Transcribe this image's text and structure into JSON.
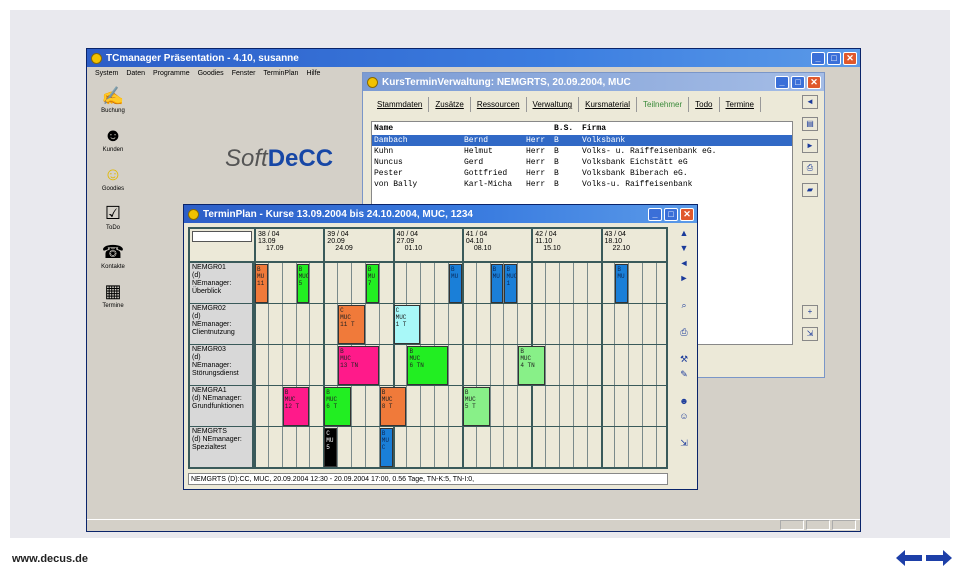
{
  "footer": {
    "url": "www.decus.de"
  },
  "app": {
    "title": "TCmanager Präsentation - 4.10, susanne",
    "menu": [
      "System",
      "Daten",
      "Programme",
      "Goodies",
      "Fenster",
      "TerminPlan",
      "Hilfe"
    ],
    "sidebar": [
      {
        "icon": "booking-icon",
        "label": "Buchung"
      },
      {
        "icon": "customers-icon",
        "label": "Kunden"
      },
      {
        "icon": "smiley-icon",
        "label": "Goodies"
      },
      {
        "icon": "todo-icon",
        "label": "ToDo"
      },
      {
        "icon": "phone-icon",
        "label": "Kontakte"
      },
      {
        "icon": "calendar-icon",
        "label": "Termine"
      }
    ],
    "logo_a": "Soft",
    "logo_b": "DeCC"
  },
  "kurs": {
    "title": "KursTerminVerwaltung: NEMGRTS, 20.09.2004, MUC",
    "tabs": [
      "Stammdaten",
      "Zusätze",
      "Ressourcen",
      "Verwaltung",
      "Kursmaterial",
      "Teilnehmer",
      "Todo",
      "Termine"
    ],
    "active_tab": "Teilnehmer",
    "headers": {
      "name": "Name",
      "vorname": "",
      "anrede": "",
      "bs": "B.S.",
      "firma": "Firma"
    },
    "rows": [
      {
        "name": "Dambach",
        "vorname": "Bernd",
        "anrede": "Herr",
        "bs": "B",
        "firma": "Volksbank"
      },
      {
        "name": "Kuhn",
        "vorname": "Helmut",
        "anrede": "Herr",
        "bs": "B",
        "firma": "Volks- u. Raiffeisenbank eG."
      },
      {
        "name": "Nuncus",
        "vorname": "Gerd",
        "anrede": "Herr",
        "bs": "B",
        "firma": "Volksbank Eichstätt eG"
      },
      {
        "name": "Pester",
        "vorname": "Gottfried",
        "anrede": "Herr",
        "bs": "B",
        "firma": "Volksbank Biberach eG."
      },
      {
        "name": "von Bally",
        "vorname": "Karl-Micha",
        "anrede": "Herr",
        "bs": "B",
        "firma": "Volks-u. Raiffeisenbank"
      }
    ]
  },
  "tp": {
    "title": "TerminPlan - Kurse 13.09.2004 bis 24.10.2004, MUC, 1234",
    "weeks": [
      {
        "w": "38 / 04",
        "d1": "13.09",
        "d2": "17.09"
      },
      {
        "w": "39 / 04",
        "d1": "20.09",
        "d2": "24.09"
      },
      {
        "w": "40 / 04",
        "d1": "27.09",
        "d2": "01.10"
      },
      {
        "w": "41 / 04",
        "d1": "04.10",
        "d2": "08.10"
      },
      {
        "w": "42 / 04",
        "d1": "11.10",
        "d2": "15.10"
      },
      {
        "w": "43 / 04",
        "d1": "18.10",
        "d2": "22.10"
      }
    ],
    "rows": [
      {
        "code": "NEMGR01",
        "l2": "(d)",
        "l3": "NEmanager:",
        "l4": "Überblick"
      },
      {
        "code": "NEMGR02",
        "l2": "(d)",
        "l3": "NEmanager:",
        "l4": "Clientnutzung"
      },
      {
        "code": "NEMGR03",
        "l2": "(d)",
        "l3": "NEmanager:",
        "l4": "Störungsdienst"
      },
      {
        "code": "NEMGRA1",
        "l2": "(d)  NEmanager:",
        "l3": "Grundfunktionen",
        "l4": ""
      },
      {
        "code": "NEMGRTS",
        "l2": "(d)  NEmanager:",
        "l3": "Spezialtest",
        "l4": ""
      }
    ],
    "status": "NEMGRTS   (D):CC, MUC, 20.09.2004 12:30 - 20.09.2004 17:00,   0.56 Tage, TN-K:5, TN-I:0,",
    "colors": {
      "orange": "#f07a3a",
      "green": "#22ee22",
      "blue": "#1a7fd8",
      "pink": "#ff1a8a",
      "cyan": "#a8f8f8",
      "lgreen": "#88f088",
      "black": "#000000"
    },
    "blocks": [
      {
        "row": 0,
        "col": 0,
        "text": "B\nMU\n11",
        "color": "orange"
      },
      {
        "row": 0,
        "col": 3,
        "text": "B\nMUC\n5",
        "color": "green"
      },
      {
        "row": 0,
        "col": 8,
        "text": "B\nMU\n7",
        "color": "green"
      },
      {
        "row": 0,
        "col": 14,
        "text": "B\nMU\n",
        "color": "blue"
      },
      {
        "row": 0,
        "col": 17,
        "text": "B\nMU\n",
        "color": "blue"
      },
      {
        "row": 0,
        "col": 18,
        "text": "B\nMUC\n1",
        "color": "blue"
      },
      {
        "row": 0,
        "col": 26,
        "text": "B\nMU",
        "color": "blue"
      },
      {
        "row": 1,
        "col": 6,
        "text": "C\nMUC\n11 T",
        "color": "orange"
      },
      {
        "row": 1,
        "col": 10,
        "text": "C\nMUC\n1  T",
        "color": "cyan"
      },
      {
        "row": 2,
        "col": 6,
        "text": "B\nMUC\n13 TN",
        "color": "pink"
      },
      {
        "row": 2,
        "col": 11,
        "text": "B\nMUC\n6  TN",
        "color": "green"
      },
      {
        "row": 2,
        "col": 19,
        "text": "B\nMUC\n4  TN",
        "color": "lgreen"
      },
      {
        "row": 3,
        "col": 2,
        "text": "B\nMUC\n12 T",
        "color": "pink"
      },
      {
        "row": 3,
        "col": 5,
        "text": "B\nMUC\n6  T",
        "color": "green"
      },
      {
        "row": 3,
        "col": 9,
        "text": "B\nMUC\n8  T",
        "color": "orange"
      },
      {
        "row": 3,
        "col": 15,
        "text": "B\nMUC\n5  T",
        "color": "lgreen"
      },
      {
        "row": 4,
        "col": 5,
        "text": "C\nMU\n5",
        "color": "black"
      },
      {
        "row": 4,
        "col": 9,
        "text": "B\nMU\nC",
        "color": "blue"
      }
    ]
  }
}
